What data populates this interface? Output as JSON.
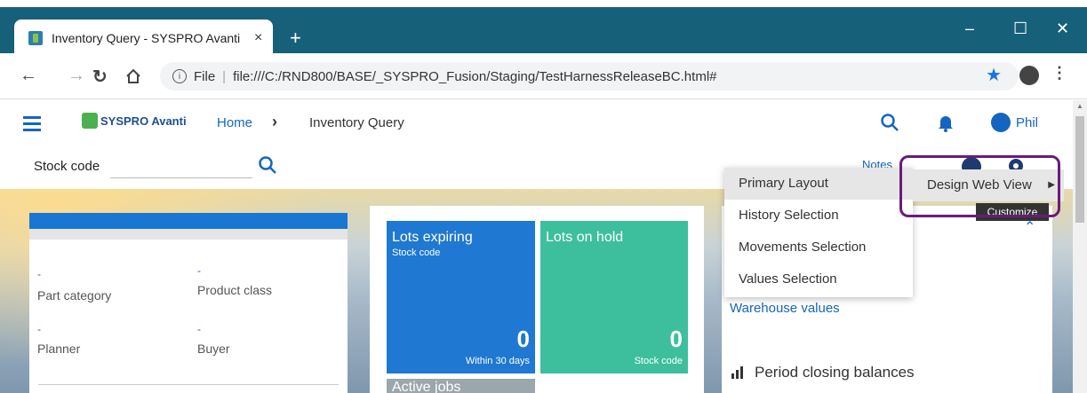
{
  "browser": {
    "tab_title": "Inventory Query - SYSPRO Avanti",
    "tab_close": "×",
    "new_tab": "+",
    "win_min": "–",
    "win_max": "☐",
    "win_close": "✕",
    "url_scheme": "File",
    "url": "file:///C:/RND800/BASE/_SYSPRO_Fusion/Staging/TestHarnessReleaseBC.html#",
    "info_glyph": "i"
  },
  "header": {
    "logo_text": "SYSPRO Avanti",
    "breadcrumb_home": "Home",
    "breadcrumb_sep": "›",
    "breadcrumb_current": "Inventory Query",
    "user_name": "Phil"
  },
  "stock": {
    "label": "Stock code",
    "value": ""
  },
  "toolbar": {
    "notes_label": "Notes"
  },
  "card1": {
    "part_category_value": "-",
    "part_category_label": "Part category",
    "product_class_value": "-",
    "product_class_label": "Product class",
    "planner_value": "-",
    "planner_label": "Planner",
    "buyer_value": "-",
    "buyer_label": "Buyer"
  },
  "tiles": [
    {
      "title": "Lots expiring",
      "subtitle": "Stock code",
      "value": "0",
      "footer": "Within 30 days",
      "color": "#1f78d1"
    },
    {
      "title": "Lots on hold",
      "subtitle": "",
      "value": "0",
      "footer": "Stock code",
      "color": "#3dbf9e"
    }
  ],
  "tile3_title": "Active jobs",
  "right_panel": {
    "warehouse_values": "Warehouse values",
    "period_closing": "Period closing balances"
  },
  "menu": {
    "items": [
      "Primary Layout",
      "History Selection",
      "Movements Selection",
      "Values Selection"
    ],
    "submenu": "Design Web View",
    "tooltip": "Customize"
  },
  "colors": {
    "tab_strip": "#17607a",
    "accent": "#1565c0",
    "highlight": "#6a1b7a"
  }
}
